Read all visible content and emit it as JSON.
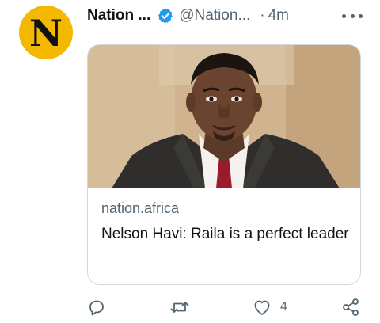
{
  "tweet": {
    "avatar_letter": "N",
    "display_name": "Nation ...",
    "handle": "@Nation...",
    "separator": "·",
    "time": "4m",
    "verified": true,
    "card": {
      "image_subject": "portrait of a man in a dark coat and red tie",
      "domain": "nation.africa",
      "headline": "Nelson Havi: Raila is a perfect leader"
    },
    "actions": {
      "reply_count": "",
      "retweet_count": "",
      "like_count": "4",
      "share_count": ""
    }
  },
  "colors": {
    "avatar_bg": "#f5b800",
    "verified_blue": "#1d9bf0",
    "secondary_text": "#536471",
    "border": "#cfd9de"
  },
  "icons": [
    "verified-badge-icon",
    "more-icon",
    "reply-icon",
    "retweet-icon",
    "like-icon",
    "share-icon"
  ]
}
